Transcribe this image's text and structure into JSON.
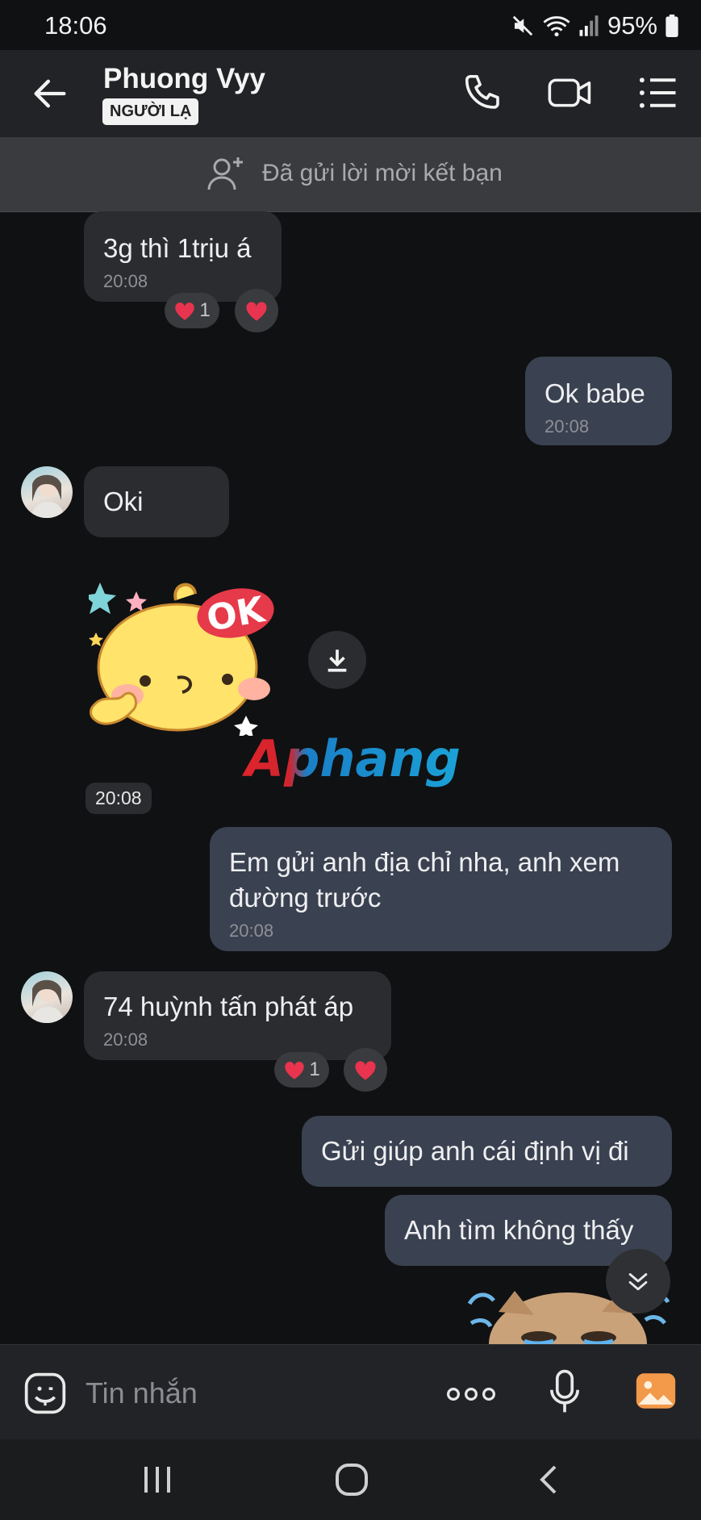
{
  "status_bar": {
    "time": "18:06",
    "battery": "95%"
  },
  "header": {
    "name": "Phuong Vyy",
    "badge": "NGƯỜI LẠ"
  },
  "banner": {
    "text": "Đã gửi lời mời kết bạn"
  },
  "messages": [
    {
      "text": "3g thì 1trịu á",
      "time": "20:08",
      "reaction_count": "1"
    },
    {
      "text": "Ok babe",
      "time": "20:08"
    },
    {
      "text": "Oki"
    },
    {
      "sticker_time": "20:08",
      "watermark": "Aphang"
    },
    {
      "text": "Em gửi anh địa chỉ nha, anh xem đường trước",
      "time": "20:08"
    },
    {
      "text": "74 huỳnh tấn phát áp",
      "time": "20:08",
      "reaction_count": "1"
    },
    {
      "text": "Gửi giúp anh cái định vị đi"
    },
    {
      "text": "Anh tìm không thấy"
    }
  ],
  "input": {
    "placeholder": "Tin nhắn"
  },
  "colors": {
    "accent": "#2a7cff",
    "heart": "#e8344e",
    "outgoing_bubble": "#3a4150",
    "incoming_bubble": "#2b2c2f"
  }
}
